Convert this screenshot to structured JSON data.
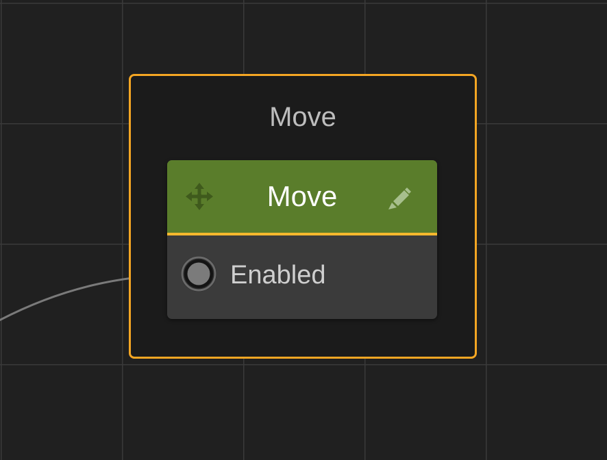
{
  "group": {
    "title": "Move"
  },
  "node": {
    "title": "Move",
    "header_icon": "move-arrows-icon",
    "edit_icon": "pencil-icon",
    "ports": [
      {
        "label": "Enabled",
        "icon": "socket-connected-icon"
      }
    ]
  },
  "colors": {
    "background": "#202020",
    "grid": "#3a3a3a",
    "group_border": "#f5a623",
    "group_fill": "#1b1b1b",
    "node_header": "#5a7d2b",
    "header_underline": "#f5b82e",
    "node_body": "#3b3b3b",
    "wire": "#7a7a7a"
  }
}
